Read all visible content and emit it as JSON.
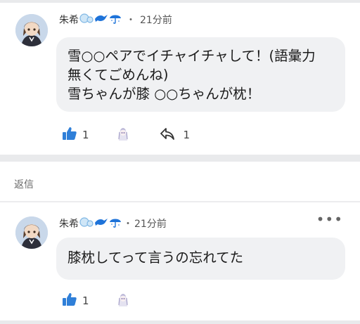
{
  "comments": [
    {
      "username": "朱希",
      "time": "21分前",
      "text": "雪○○ペアでイチャイチャして！(語彙力\n無くてごめんね)\n雪ちゃんが膝 ○○ちゃんが枕！",
      "likes": "1",
      "replies": "1"
    },
    {
      "username": "朱希",
      "time": "21分前",
      "text": "膝枕してって言うの忘れてた",
      "likes": "1"
    }
  ],
  "reply_section_label": "返信",
  "colors": {
    "like_icon": "#2f7fd8",
    "badge_blue": "#1e73d9",
    "bubble_bg": "#f0f1f3",
    "divider": "#e9eaec"
  },
  "icons": [
    "thumbs-up-icon",
    "character-reaction-icon",
    "reply-icon",
    "more-options-icon",
    "bubble-badge-icon",
    "bird-badge-icon",
    "umbrella-badge-icon"
  ]
}
